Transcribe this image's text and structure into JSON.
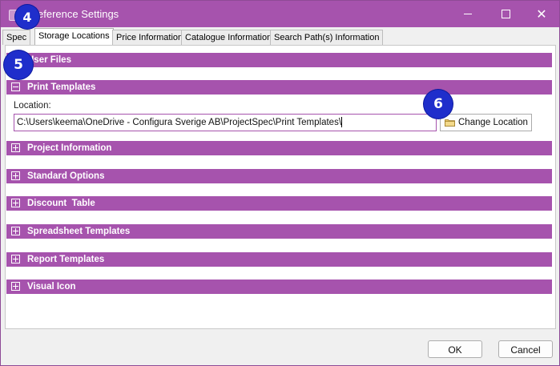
{
  "window": {
    "title": "Preference Settings",
    "controls": {
      "minimize": "—",
      "maximize": "☐",
      "close": "✕"
    }
  },
  "tabs": [
    {
      "label": "Spec"
    },
    {
      "label": "Storage Locations",
      "active": true
    },
    {
      "label": "Price Information"
    },
    {
      "label": "Catalogue Information"
    },
    {
      "label": "Search Path(s) Information"
    }
  ],
  "sections": [
    {
      "label": "User Files",
      "expanded": false
    },
    {
      "label": "Print Templates",
      "expanded": true
    },
    {
      "label": "Project Information",
      "expanded": false
    },
    {
      "label": "Standard Options",
      "expanded": false
    },
    {
      "label": "Discount  Table",
      "expanded": false
    },
    {
      "label": "Spreadsheet Templates",
      "expanded": false
    },
    {
      "label": "Report Templates",
      "expanded": false
    },
    {
      "label": "Visual Icon",
      "expanded": false
    }
  ],
  "print_templates": {
    "location_label": "Location:",
    "location_value": "C:\\Users\\keema\\OneDrive - Configura Sverige AB\\ProjectSpec\\Print Templates\\",
    "change_button": "Change Location",
    "change_icon": "folder-icon"
  },
  "callouts": {
    "c4": "4",
    "c5": "5",
    "c6": "6"
  },
  "footer": {
    "ok": "OK",
    "cancel": "Cancel"
  },
  "colors": {
    "accent": "#a653ad",
    "callout": "#1f2ecb"
  }
}
